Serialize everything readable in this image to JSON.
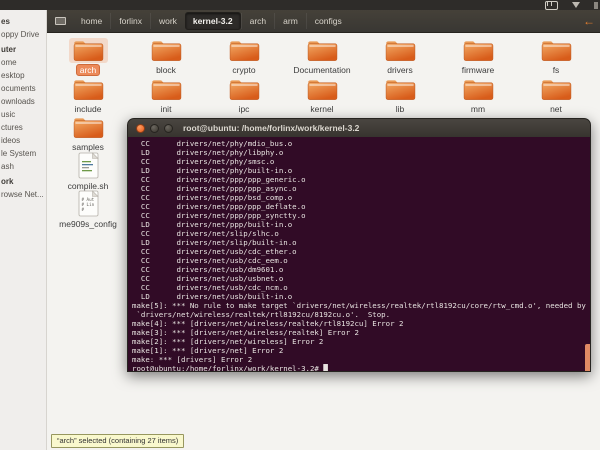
{
  "top_panel": {
    "indicators": [
      "message-indicator",
      "sound-indicator"
    ]
  },
  "toolbar": {
    "location_icon": "computer-icon",
    "breadcrumbs": [
      {
        "label": "home"
      },
      {
        "label": "forlinx"
      },
      {
        "label": "work"
      },
      {
        "label": "kernel-3.2",
        "active": true
      },
      {
        "label": "arch"
      },
      {
        "label": "arm"
      },
      {
        "label": "configs"
      }
    ],
    "scroll_arrow": "←"
  },
  "sidebar": {
    "items": [
      {
        "label": "es",
        "bold": true
      },
      {
        "label": "oppy Drive"
      },
      {
        "label": "uter",
        "bold": true
      },
      {
        "label": "ome"
      },
      {
        "label": "esktop"
      },
      {
        "label": "ocuments"
      },
      {
        "label": "ownloads"
      },
      {
        "label": "usic"
      },
      {
        "label": "ctures"
      },
      {
        "label": "ideos"
      },
      {
        "label": "le System"
      },
      {
        "label": "ash"
      },
      {
        "label": "ork",
        "bold": true
      },
      {
        "label": "rowse Net..."
      }
    ]
  },
  "files": {
    "row1": [
      {
        "label": "arch",
        "icon": "folder",
        "selected": true
      },
      {
        "label": "block",
        "icon": "folder"
      },
      {
        "label": "crypto",
        "icon": "folder"
      },
      {
        "label": "Documentation",
        "icon": "folder"
      },
      {
        "label": "drivers",
        "icon": "folder"
      },
      {
        "label": "firmware",
        "icon": "folder"
      },
      {
        "label": "fs",
        "icon": "folder"
      }
    ],
    "row2": [
      {
        "label": "include",
        "icon": "folder"
      },
      {
        "label": "init",
        "icon": "folder"
      },
      {
        "label": "ipc",
        "icon": "folder"
      },
      {
        "label": "kernel",
        "icon": "folder"
      },
      {
        "label": "lib",
        "icon": "folder"
      },
      {
        "label": "mm",
        "icon": "folder"
      },
      {
        "label": "net",
        "icon": "folder"
      }
    ],
    "extra1": [
      {
        "label": "samples",
        "icon": "folder"
      }
    ],
    "extra2": [
      {
        "label": "compile.sh",
        "icon": "script"
      }
    ],
    "extra3": [
      {
        "label": "me909s_config",
        "icon": "config"
      }
    ]
  },
  "terminal": {
    "title": "root@ubuntu: /home/forlinx/work/kernel-3.2",
    "lines": [
      "  CC      drivers/net/phy/mdio_bus.o",
      "  LD      drivers/net/phy/libphy.o",
      "  CC      drivers/net/phy/smsc.o",
      "  LD      drivers/net/phy/built-in.o",
      "  CC      drivers/net/ppp/ppp_generic.o",
      "  CC      drivers/net/ppp/ppp_async.o",
      "  CC      drivers/net/ppp/bsd_comp.o",
      "  CC      drivers/net/ppp/ppp_deflate.o",
      "  CC      drivers/net/ppp/ppp_synctty.o",
      "  LD      drivers/net/ppp/built-in.o",
      "  CC      drivers/net/slip/slhc.o",
      "  LD      drivers/net/slip/built-in.o",
      "  CC      drivers/net/usb/cdc_ether.o",
      "  CC      drivers/net/usb/cdc_eem.o",
      "  CC      drivers/net/usb/dm9601.o",
      "  CC      drivers/net/usb/usbnet.o",
      "  CC      drivers/net/usb/cdc_ncm.o",
      "  LD      drivers/net/usb/built-in.o",
      "make[5]: *** No rule to make target `drivers/net/wireless/realtek/rtl8192cu/core/rtw_cmd.o', needed by",
      " `drivers/net/wireless/realtek/rtl8192cu/8192cu.o'.  Stop.",
      "make[4]: *** [drivers/net/wireless/realtek/rtl8192cu] Error 2",
      "make[3]: *** [drivers/net/wireless/realtek] Error 2",
      "make[2]: *** [drivers/net/wireless] Error 2",
      "make[1]: *** [drivers/net] Error 2",
      "make: *** [drivers] Error 2",
      "root@ubuntu:/home/forlinx/work/kernel-3.2# █"
    ],
    "colors": {
      "background": "#310b26",
      "text": "#e8e4e1",
      "scrollbar": "#e08a64"
    }
  },
  "tooltip": {
    "text": "“arch” selected (containing 27 items)"
  },
  "colors": {
    "accent_orange": "#e8814f",
    "folder_orange_top": "#f2a964",
    "folder_orange_bottom": "#d85c1a",
    "panel_dark": "#2e2c29",
    "toolbar_dark": "#3b3834",
    "sidebar_bg": "#f0eeec",
    "content_bg": "#f4f3f0"
  }
}
